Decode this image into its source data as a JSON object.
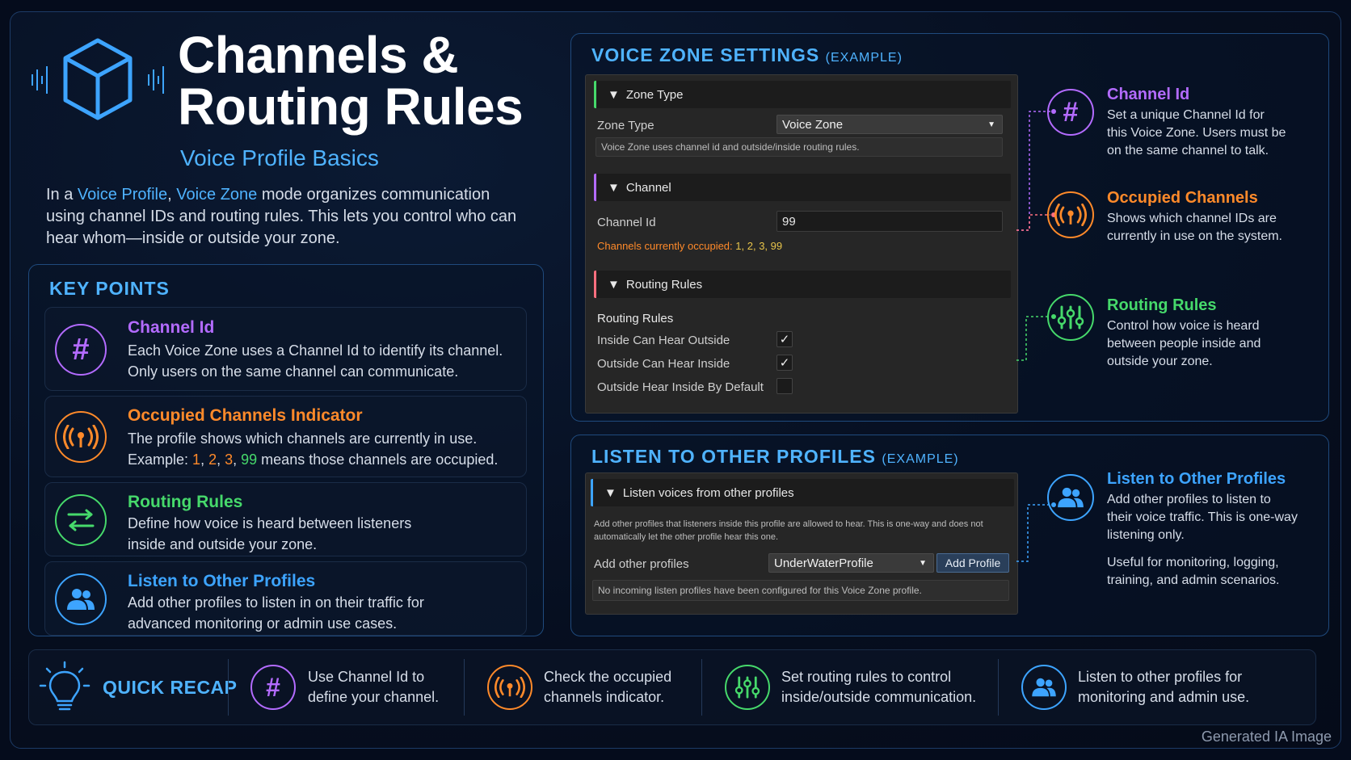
{
  "header": {
    "title_line1": "Channels &",
    "title_line2": "Routing Rules",
    "subtitle": "Voice Profile Basics",
    "intro_pre": "In a ",
    "intro_hl1": "Voice Profile",
    "intro_mid": ", ",
    "intro_hl2": "Voice Zone",
    "intro_post": " mode organizes communication using channel IDs and routing rules. This lets you control who can hear whom—inside or outside your zone."
  },
  "key_points": {
    "title": "KEY POINTS",
    "items": [
      {
        "title": "Channel Id",
        "line1": "Each Voice Zone uses a Channel Id to identify its channel.",
        "line2": "Only users on the same channel can communicate.",
        "color": "#b36bff",
        "icon": "hash-icon"
      },
      {
        "title": "Occupied Channels Indicator",
        "line1": "The profile shows which channels are currently in use.",
        "line2_pre": "Example: ",
        "ex1": "1",
        "ex2": "2",
        "ex3": "3",
        "ex4": "99",
        "line2_post": " means those channels are occupied.",
        "color": "#ff8a2a",
        "icon": "broadcast-icon"
      },
      {
        "title": "Routing Rules",
        "line1": "Define how voice is heard between listeners",
        "line2": "inside and outside your zone.",
        "color": "#46d96b",
        "icon": "swap-arrows-icon"
      },
      {
        "title": "Listen to Other Profiles",
        "line1": "Add other profiles to listen in on their traffic for",
        "line2": "advanced monitoring or admin use cases.",
        "color": "#3da4ff",
        "icon": "users-icon"
      }
    ]
  },
  "voice_zone": {
    "title": "VOICE ZONE SETTINGS",
    "title_suffix": "(EXAMPLE)",
    "zone_type_header": "Zone Type",
    "zone_type_label": "Zone Type",
    "zone_type_value": "Voice Zone",
    "zone_type_help": "Voice Zone uses channel id and outside/inside routing rules.",
    "channel_header": "Channel",
    "channel_label": "Channel Id",
    "channel_value": "99",
    "occupied_label": "Channels currently occupied:",
    "occupied_values": "1, 2, 3, 99",
    "routing_header": "Routing Rules",
    "routing_sub": "Routing Rules",
    "rules": [
      {
        "label": "Inside Can Hear Outside",
        "checked": true
      },
      {
        "label": "Outside Can Hear Inside",
        "checked": true
      },
      {
        "label": "Outside Hear Inside By Default",
        "checked": false
      }
    ],
    "check_glyph": "✓"
  },
  "annotations": [
    {
      "title": "Channel Id",
      "line1": "Set a unique Channel Id for",
      "line2": "this Voice Zone. Users must be",
      "line3": "on the same channel to talk.",
      "color": "#b36bff"
    },
    {
      "title": "Occupied Channels",
      "line1": "Shows which channel IDs are",
      "line2": "currently in use on the system.",
      "color": "#ff8a2a"
    },
    {
      "title": "Routing Rules",
      "line1": "Control how voice is heard",
      "line2": "between people inside and",
      "line3": "outside your zone.",
      "color": "#46d96b"
    }
  ],
  "listen": {
    "title": "LISTEN TO OTHER PROFILES",
    "title_suffix": "(EXAMPLE)",
    "header": "Listen voices from other profiles",
    "help_line1": "Add other profiles that listeners inside this profile are allowed to hear. This is one-way and does not",
    "help_line2": "automatically let the other profile hear this one.",
    "add_label": "Add other profiles",
    "dropdown_value": "UnderWaterProfile",
    "add_button": "Add Profile",
    "status": "No incoming listen profiles have been configured for this Voice Zone profile.",
    "ann_title": "Listen to Other Profiles",
    "ann_line1": "Add other profiles to listen to",
    "ann_line2": "their voice traffic. This is one-way",
    "ann_line3": "listening only.",
    "ann_line4": "Useful for monitoring, logging,",
    "ann_line5": "training, and admin scenarios."
  },
  "recap": {
    "title": "QUICK RECAP",
    "items": [
      {
        "line1": "Use Channel Id to",
        "line2": "define your channel.",
        "color": "#b36bff"
      },
      {
        "line1": "Check the occupied",
        "line2": "channels indicator.",
        "color": "#ff8a2a"
      },
      {
        "line1": "Set routing rules to control",
        "line2": "inside/outside communication.",
        "color": "#46d96b"
      },
      {
        "line1": "Listen to other profiles for",
        "line2": "monitoring and admin use.",
        "color": "#3da4ff"
      }
    ]
  },
  "footer": "Generated IA Image",
  "colors": {
    "accent": "#4fb3ff",
    "purple": "#b36bff",
    "orange": "#ff8a2a",
    "green": "#46d96b",
    "blue": "#3da4ff"
  }
}
